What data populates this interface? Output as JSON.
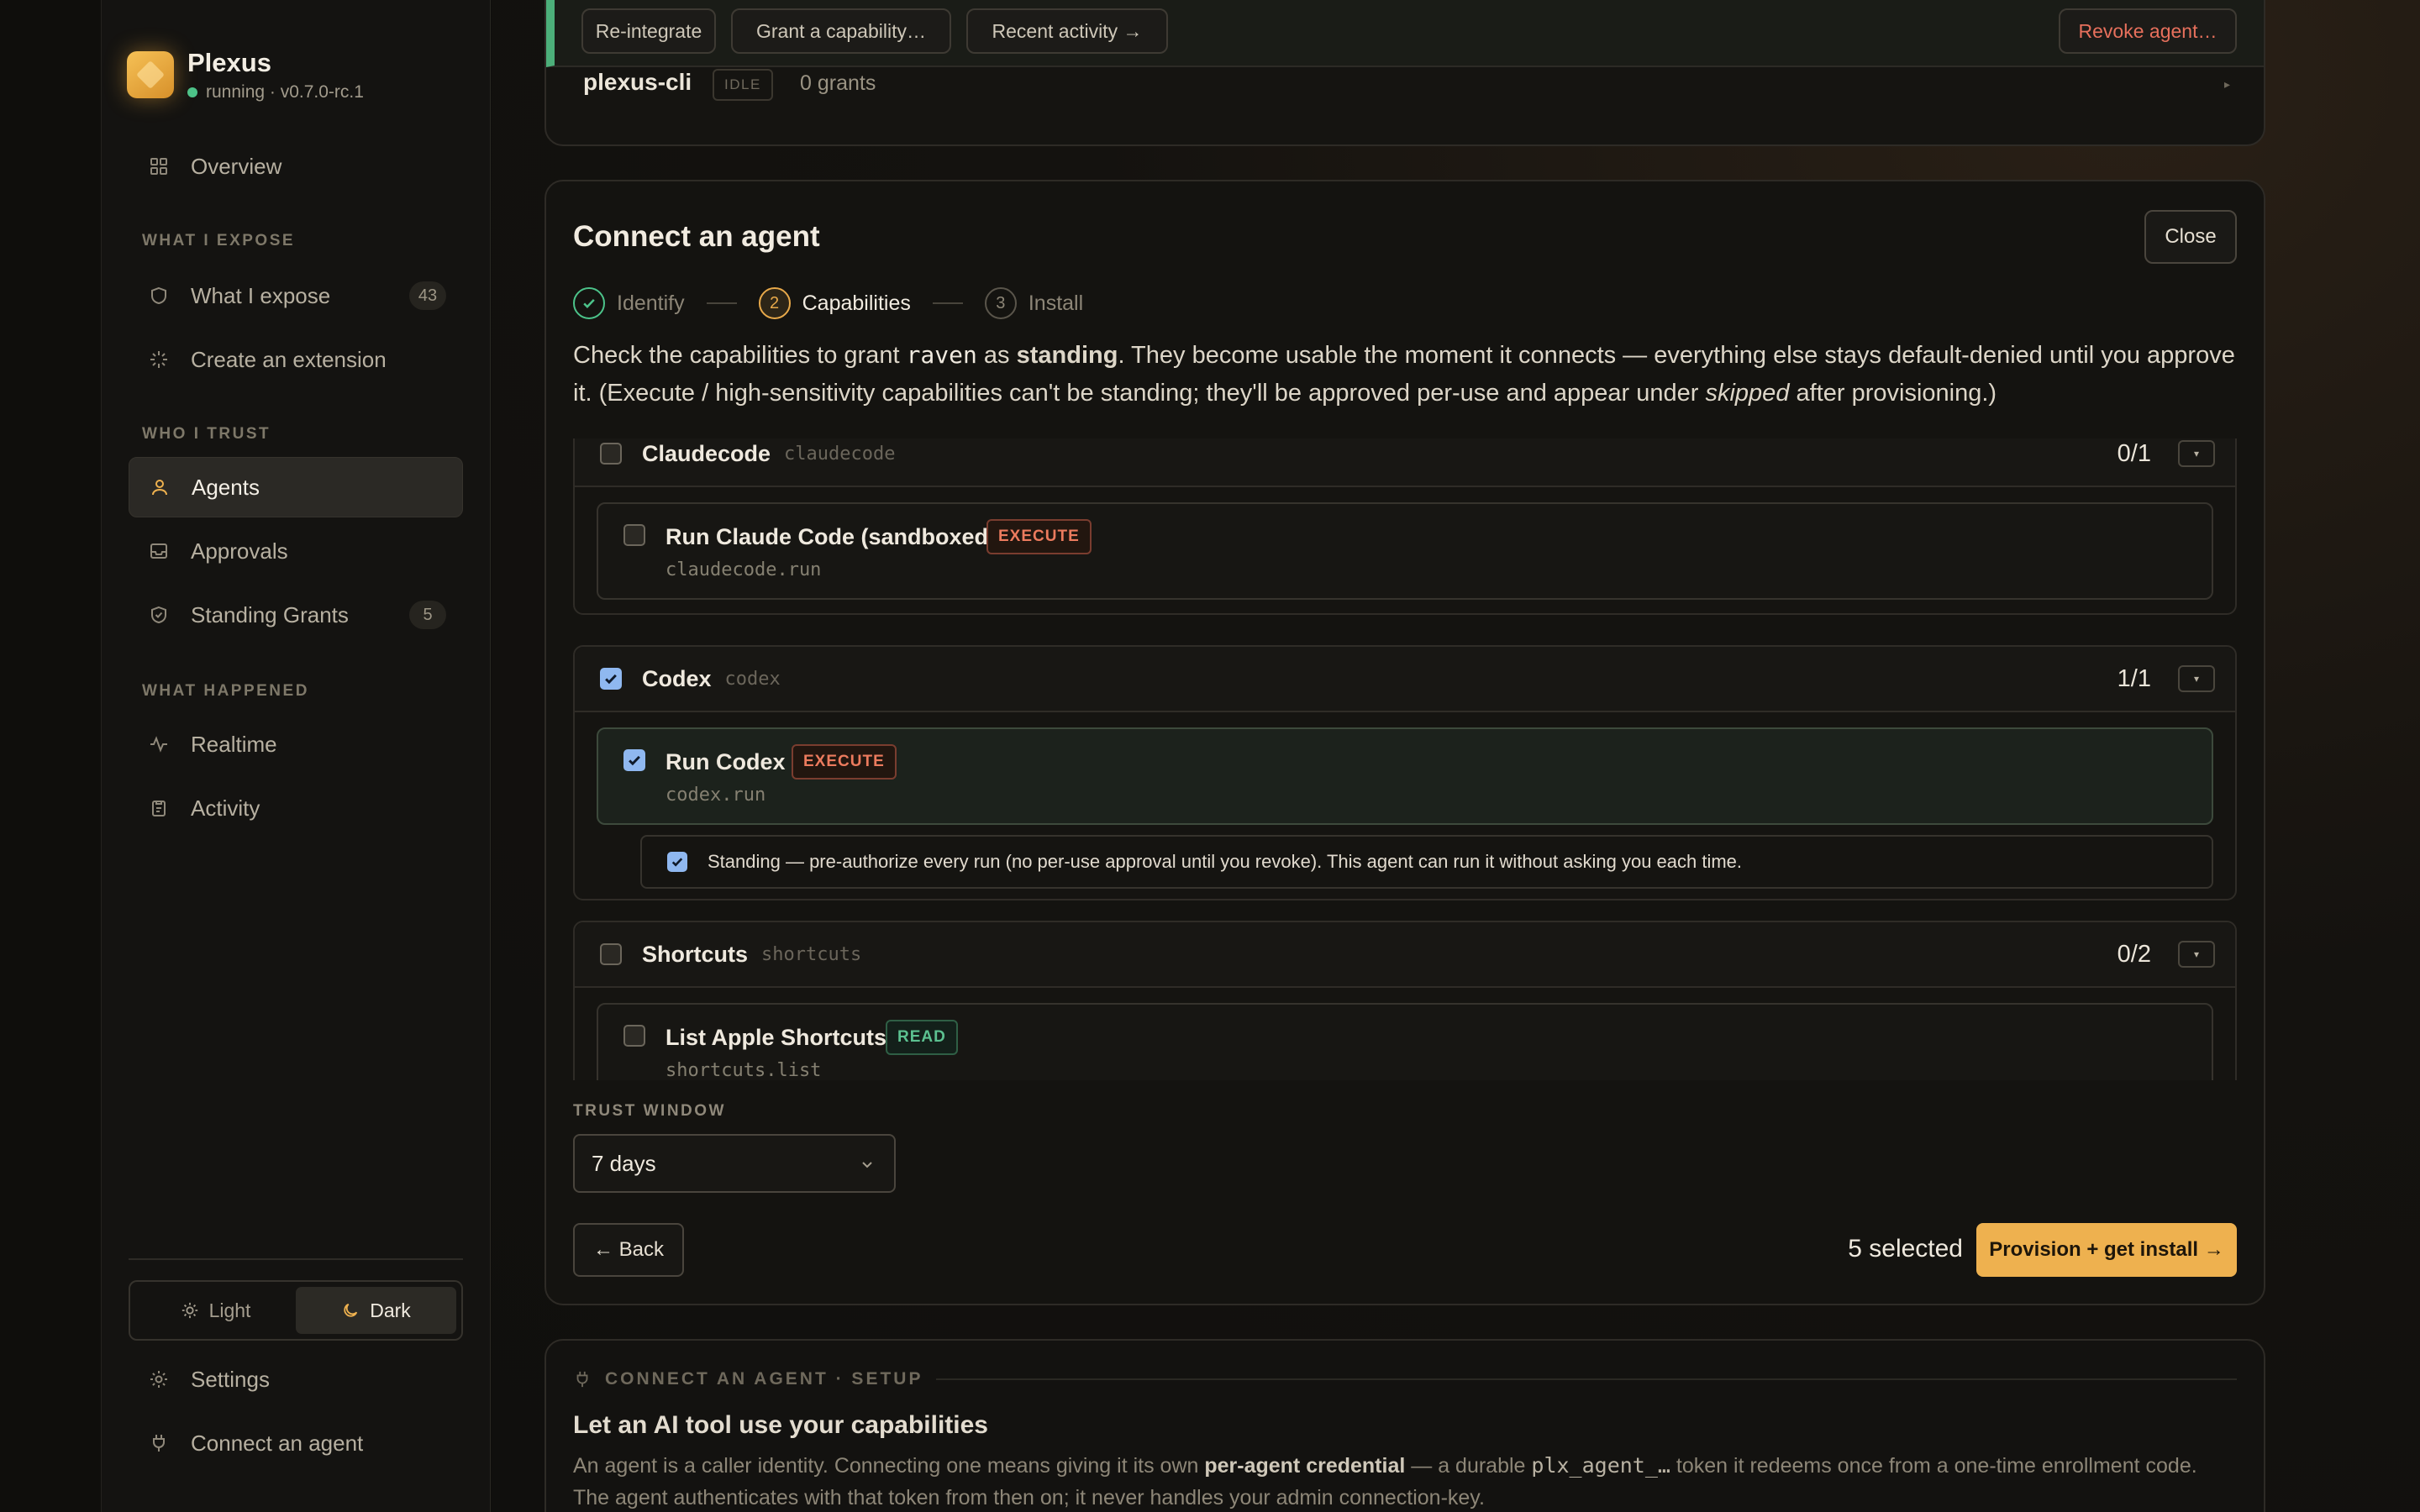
{
  "app": {
    "name": "Plexus",
    "status": "running · v0.7.0-rc.1",
    "status_color": "#4cc38a",
    "accent": "#eeb14f"
  },
  "sidebar": {
    "overview": "Overview",
    "sections": {
      "expose": "WHAT I EXPOSE",
      "trust": "WHO I TRUST",
      "happened": "WHAT HAPPENED"
    },
    "items": {
      "what_i_expose": {
        "label": "What I expose",
        "count": "43"
      },
      "create_extension": {
        "label": "Create an extension"
      },
      "agents": {
        "label": "Agents"
      },
      "approvals": {
        "label": "Approvals"
      },
      "standing_grants": {
        "label": "Standing Grants",
        "count": "5"
      },
      "realtime": {
        "label": "Realtime"
      },
      "activity": {
        "label": "Activity"
      }
    },
    "theme": {
      "light": "Light",
      "dark": "Dark",
      "selected": "Dark"
    },
    "settings": "Settings",
    "connect_agent": "Connect an agent"
  },
  "top_card": {
    "buttons": {
      "reintegrate": "Re-integrate",
      "grant": "Grant a capability…",
      "recent": "Recent activity →",
      "revoke": "Revoke agent…"
    },
    "row": {
      "name": "plexus-cli",
      "badge": "IDLE",
      "grants": "0 grants",
      "caret": "▸"
    }
  },
  "connect": {
    "title": "Connect an agent",
    "close": "Close",
    "steps": [
      {
        "num": "✓",
        "label": "Identify"
      },
      {
        "num": "2",
        "label": "Capabilities"
      },
      {
        "num": "3",
        "label": "Install"
      }
    ],
    "desc": {
      "p1": "Check the capabilities to grant ",
      "agent": "raven",
      "p2": " as ",
      "standing": "standing",
      "p3": ". They become usable the moment it connects — everything else stays default-denied until you approve it. (Execute / high-sensitivity capabilities can't be standing; they'll be approved per-use and appear under ",
      "skipped": "skipped",
      "p4": " after provisioning.)"
    },
    "groups": [
      {
        "name": "Claudecode",
        "slug": "claudecode",
        "count": "0/1",
        "checked": false,
        "items": [
          {
            "name": "Run Claude Code (sandboxed)",
            "id": "claudecode.run",
            "tag": "EXECUTE",
            "checked": false
          }
        ]
      },
      {
        "name": "Codex",
        "slug": "codex",
        "count": "1/1",
        "checked": true,
        "items": [
          {
            "name": "Run Codex",
            "id": "codex.run",
            "tag": "EXECUTE",
            "checked": true
          }
        ],
        "standing": "Standing — pre-authorize every run (no per-use approval until you revoke). This agent can run it without asking you each time."
      },
      {
        "name": "Shortcuts",
        "slug": "shortcuts",
        "count": "0/2",
        "checked": false,
        "items": [
          {
            "name": "List Apple Shortcuts",
            "id": "shortcuts.list",
            "tag": "READ",
            "checked": false
          }
        ]
      }
    ],
    "trust_window": {
      "label": "TRUST WINDOW",
      "value": "7 days"
    },
    "back": "← Back",
    "selected": "5 selected",
    "provision": "Provision + get install →"
  },
  "setup": {
    "eyebrow": "CONNECT AN AGENT · SETUP",
    "title": "Let an AI tool use your capabilities",
    "body_1": "An agent is a caller identity. Connecting one means giving it its own ",
    "body_bold": "per-agent credential",
    "body_2": " — a durable ",
    "body_code": "plx_agent_…",
    "body_3": " token it redeems once from a one-time enrollment code. The agent authenticates with that token from then on; it never handles your admin connection-key."
  }
}
